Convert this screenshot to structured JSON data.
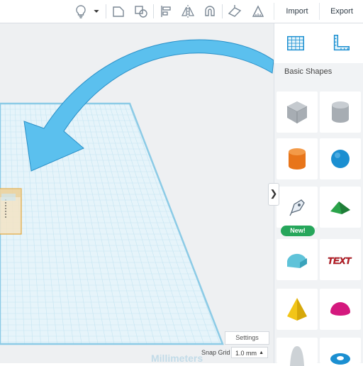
{
  "toolbar": {
    "import_label": "Import",
    "export_label": "Export",
    "icons": [
      "lightbulb-icon",
      "dropdown-icon",
      "group-icon",
      "ungroup-icon",
      "align-icon",
      "mirror-icon",
      "magnet-icon",
      "workplane-icon",
      "ruler-icon"
    ]
  },
  "workplane": {
    "units_label": "Millimeters",
    "settings_label": "Settings",
    "snap_grid_label": "Snap Grid",
    "snap_grid_value": "1.0 mm",
    "grid_color": "#a9d8ec",
    "arrow_color": "#5bc0ee"
  },
  "panel": {
    "category_label": "Basic Shapes",
    "new_badge": "New!",
    "shapes": [
      "box",
      "cylinder",
      "cylinder",
      "sphere",
      "scribble",
      "roof",
      "round-roof",
      "text",
      "pyramid",
      "half-sphere",
      "paraboloid",
      "torus"
    ],
    "shape_colors": {
      "box": "#a7adb3",
      "orange": "#e8751a",
      "blue": "#1b8fd1",
      "green": "#2aa34a",
      "teal": "#5fc3d9",
      "red": "#c8202a",
      "yellow": "#f2c518",
      "magenta": "#d4197e"
    }
  }
}
